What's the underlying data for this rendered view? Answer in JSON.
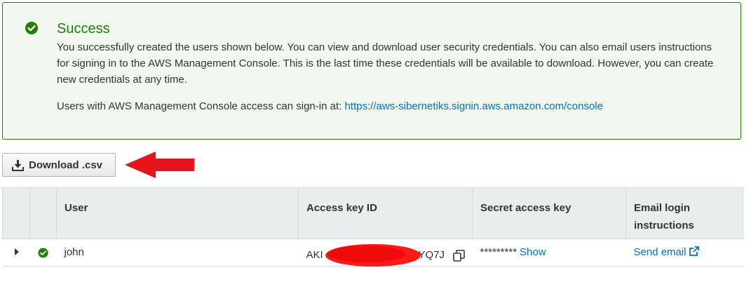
{
  "alert": {
    "title": "Success",
    "body": "You successfully created the users shown below. You can view and download user security credentials. You can also email users instructions for signing in to the AWS Management Console. This is the last time these credentials will be available to download. However, you can create new credentials at any time.",
    "signin_prefix": "Users with AWS Management Console access can sign-in at: ",
    "signin_url": "https://aws-sibernetiks.signin.aws.amazon.com/console",
    "icon": "check-circle-icon",
    "color": "#1d8102"
  },
  "toolbar": {
    "download_label": "Download .csv",
    "download_icon": "download-icon"
  },
  "annotation": {
    "arrow_color": "#e8141b"
  },
  "table": {
    "headers": [
      "User",
      "Access key ID",
      "Secret access key",
      "Email login instructions"
    ],
    "rows": [
      {
        "user": "john",
        "access_key_start": "AKI",
        "access_key_end": "YQ7J",
        "secret": "*********",
        "show_label": "Show",
        "email_label": "Send email"
      }
    ]
  },
  "colors": {
    "link": "#0073bb",
    "success": "#1d8102",
    "header_bg": "#eaeded"
  }
}
